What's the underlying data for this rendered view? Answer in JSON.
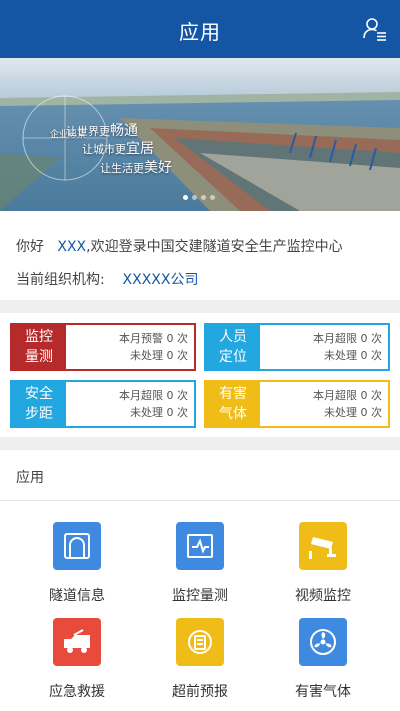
{
  "header": {
    "title": "应用",
    "user_icon": "user-menu-icon"
  },
  "banner": {
    "slogan_badge": "企业愿景",
    "slogans": [
      {
        "prefix": "让世界更",
        "emphasis": "畅通"
      },
      {
        "prefix": "让城市更",
        "emphasis": "宜居"
      },
      {
        "prefix": "让生活更",
        "emphasis": "美好"
      }
    ],
    "dots_total": 4,
    "dots_active": 1
  },
  "welcome": {
    "greeting": "你好",
    "user_name": "XXX",
    "message": ",欢迎登录中国交建隧道安全生产监控中心",
    "org_label": "当前组织机构:",
    "org_name": "XXXXX公司"
  },
  "stats": [
    {
      "id": "monitor",
      "tag_line1": "监控",
      "tag_line2": "量测",
      "line1": "本月预警 0 次",
      "line2": "未处理 0 次",
      "color": "#b52a2a"
    },
    {
      "id": "person",
      "tag_line1": "人员",
      "tag_line2": "定位",
      "line1": "本月超限 0 次",
      "line2": "未处理 0 次",
      "color": "#22a7e0"
    },
    {
      "id": "step",
      "tag_line1": "安全",
      "tag_line2": "步距",
      "line1": "本月超限 0 次",
      "line2": "未处理 0 次",
      "color": "#22a7e0"
    },
    {
      "id": "gas",
      "tag_line1": "有害",
      "tag_line2": "气体",
      "line1": "本月超限 0 次",
      "line2": "未处理 0 次",
      "color": "#f0bd18"
    }
  ],
  "apps": {
    "title": "应用",
    "items": [
      {
        "label": "隧道信息",
        "icon": "tunnel-icon",
        "color": "#3d8ae0"
      },
      {
        "label": "监控量测",
        "icon": "monitor-chart-icon",
        "color": "#3d8ae0"
      },
      {
        "label": "视频监控",
        "icon": "camera-icon",
        "color": "#f0bd18"
      },
      {
        "label": "应急救援",
        "icon": "rescue-truck-icon",
        "color": "#e84b3c"
      },
      {
        "label": "超前预报",
        "icon": "forecast-icon",
        "color": "#f0bd18"
      },
      {
        "label": "有害气体",
        "icon": "gas-fan-icon",
        "color": "#3d8ae0"
      }
    ]
  }
}
